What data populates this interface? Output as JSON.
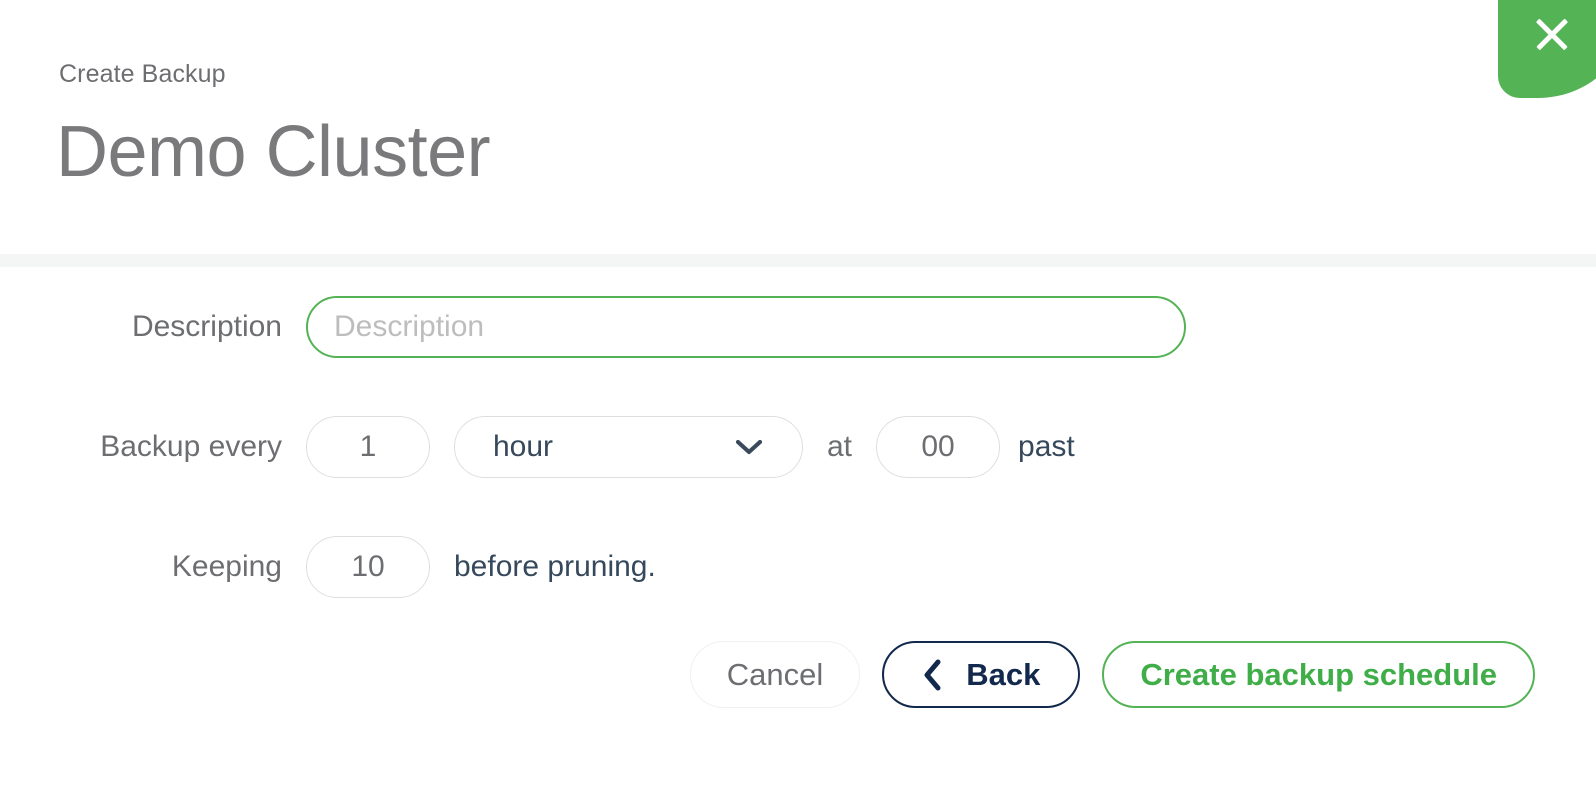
{
  "header": {
    "eyebrow": "Create Backup",
    "title": "Demo Cluster",
    "close_icon": "close-icon",
    "close_label": "Close"
  },
  "form": {
    "description": {
      "label": "Description",
      "value": "",
      "placeholder": "Description"
    },
    "interval": {
      "label": "Backup every",
      "count_value": "1",
      "unit_value": "hour",
      "unit_icon": "chevron-down-icon",
      "at_text": "at",
      "minute_value": "00",
      "past_text": "past"
    },
    "keeping": {
      "label": "Keeping",
      "count_value": "10",
      "suffix_text": "before pruning."
    }
  },
  "actions": {
    "cancel_label": "Cancel",
    "back_label": "Back",
    "back_icon": "chevron-left-icon",
    "create_label": "Create backup schedule"
  },
  "colors": {
    "accent_green": "#53b355",
    "green_text": "#3fae48",
    "navy": "#12284c",
    "slate": "#36495c",
    "muted_gray": "#6d6e71",
    "title_gray": "#7a7a7c",
    "placeholder_gray": "#bdbdbd",
    "border_gray": "#dcdfe2",
    "divider_gray": "#f4f5f5",
    "page_backdrop": "#000000"
  }
}
